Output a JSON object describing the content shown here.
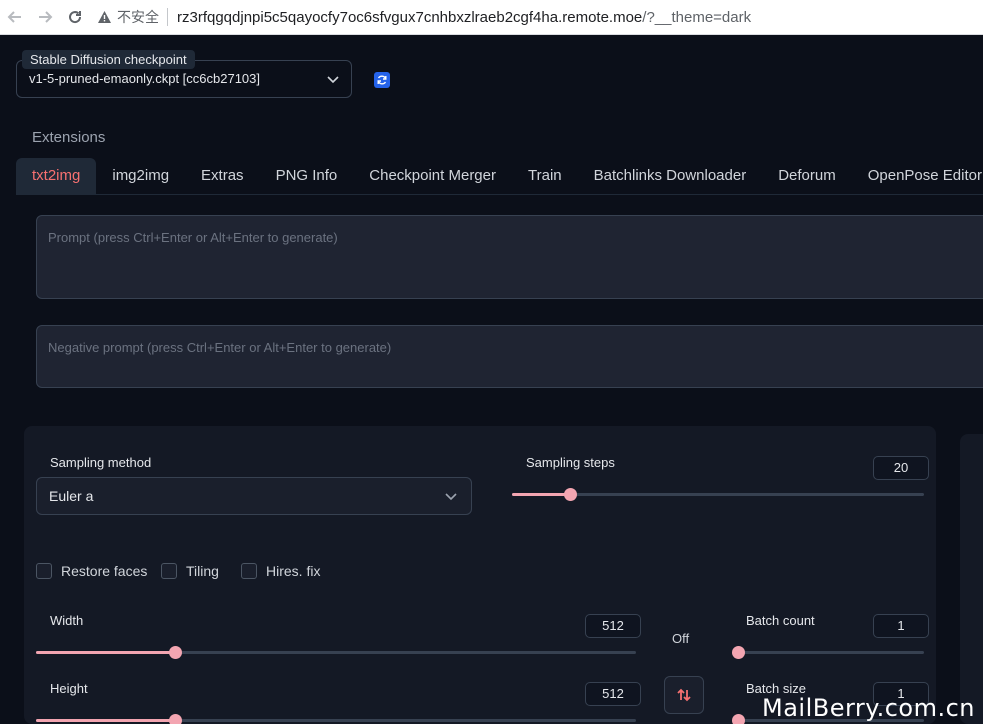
{
  "browser": {
    "insecure_label": "不安全",
    "url_host": "rz3rfqgqdjnpi5c5qayocfy7oc6sfvgux7cnhbxzlraeb2cgf4ha.remote.moe",
    "url_path": "/?__theme=dark"
  },
  "checkpoint": {
    "label": "Stable Diffusion checkpoint",
    "value": "v1-5-pruned-emaonly.ckpt [cc6cb27103]"
  },
  "extensions_label": "Extensions",
  "tabs": [
    {
      "label": "txt2img",
      "active": true
    },
    {
      "label": "img2img"
    },
    {
      "label": "Extras"
    },
    {
      "label": "PNG Info"
    },
    {
      "label": "Checkpoint Merger"
    },
    {
      "label": "Train"
    },
    {
      "label": "Batchlinks Downloader"
    },
    {
      "label": "Deforum"
    },
    {
      "label": "OpenPose Editor"
    }
  ],
  "prompt": {
    "placeholder": "Prompt (press Ctrl+Enter or Alt+Enter to generate)"
  },
  "negative_prompt": {
    "placeholder": "Negative prompt (press Ctrl+Enter or Alt+Enter to generate)"
  },
  "sampling": {
    "method_label": "Sampling method",
    "method_value": "Euler a",
    "steps_label": "Sampling steps",
    "steps_value": "20",
    "steps_fraction": 0.14
  },
  "checkboxes": [
    {
      "label": "Restore faces",
      "checked": false
    },
    {
      "label": "Tiling",
      "checked": false
    },
    {
      "label": "Hires. fix",
      "checked": false
    }
  ],
  "width": {
    "label": "Width",
    "value": "512",
    "fraction": 0.232
  },
  "height": {
    "label": "Height",
    "value": "512",
    "fraction": 0.232
  },
  "batch_count": {
    "label": "Batch count",
    "value": "1",
    "fraction": 0.0
  },
  "batch_size": {
    "label": "Batch size",
    "value": "1",
    "fraction": 0.0
  },
  "off_label": "Off",
  "watermark": "MailBerry.com.cn",
  "colors": {
    "accent": "#f87171",
    "slider": "#f3a5b1",
    "background": "#0b0f19"
  }
}
